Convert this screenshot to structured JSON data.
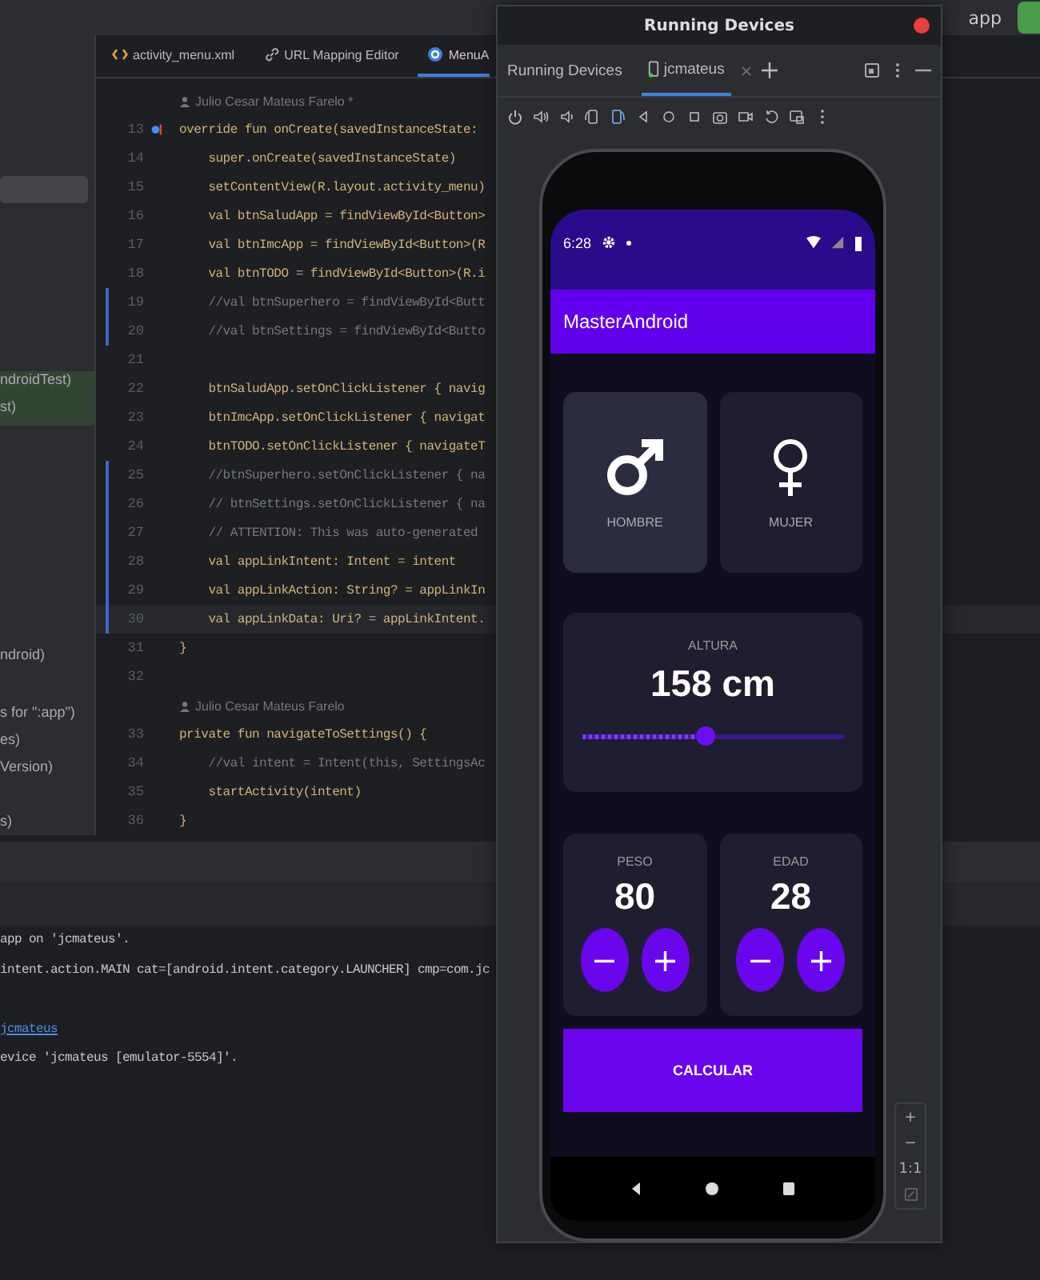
{
  "ide": {
    "run_config": "app",
    "project_rows": [
      {
        "selected": true,
        "highlighted": false
      },
      {
        "text": "ndroidTest)",
        "selected": false,
        "highlighted": true
      },
      {
        "text": "st)",
        "selected": false,
        "highlighted": true
      },
      {
        "text": "ndroid)",
        "selected": false,
        "highlighted": false
      },
      {
        "text": "s for \":app\")",
        "selected": false,
        "highlighted": false
      },
      {
        "text": "es)",
        "selected": false,
        "highlighted": false
      },
      {
        "text": "Version)",
        "selected": false,
        "highlighted": false
      },
      {
        "text": "s)",
        "selected": false,
        "highlighted": false
      }
    ],
    "editor_tabs": [
      {
        "label": "activity_menu.xml",
        "kind": "xml",
        "selected": false
      },
      {
        "label": "URL Mapping Editor",
        "kind": "link",
        "selected": false
      },
      {
        "label": "MenuA",
        "kind": "kotlin",
        "selected": true
      }
    ],
    "code_lines": [
      {
        "kind": "author",
        "text": "Julio Cesar Mateus Farelo *"
      },
      {
        "kind": "code",
        "number": "13",
        "text": "override fun onCreate(savedInstanceState:",
        "modified": false,
        "current": false,
        "gutter_icon": true
      },
      {
        "kind": "code",
        "number": "14",
        "text": "    super.onCreate(savedInstanceState)",
        "modified": false,
        "current": false,
        "gutter_icon": false
      },
      {
        "kind": "code",
        "number": "15",
        "text": "    setContentView(R.layout.activity_menu)",
        "modified": false,
        "current": false,
        "gutter_icon": false
      },
      {
        "kind": "code",
        "number": "16",
        "text": "    val btnSaludApp = findViewById<Button>",
        "modified": false,
        "current": false,
        "gutter_icon": false
      },
      {
        "kind": "code",
        "number": "17",
        "text": "    val btnImcApp = findViewById<Button>(R",
        "modified": false,
        "current": false,
        "gutter_icon": false
      },
      {
        "kind": "code",
        "number": "18",
        "text": "    val btnTODO = findViewById<Button>(R.i",
        "modified": false,
        "current": false,
        "gutter_icon": false
      },
      {
        "kind": "comment",
        "number": "19",
        "text": "    //val btnSuperhero = findViewById<Butt",
        "modified": true,
        "current": false,
        "gutter_icon": false
      },
      {
        "kind": "comment",
        "number": "20",
        "text": "    //val btnSettings = findViewById<Butto",
        "modified": true,
        "current": false,
        "gutter_icon": false
      },
      {
        "kind": "code",
        "number": "21",
        "modified": false,
        "current": false,
        "gutter_icon": false
      },
      {
        "kind": "code",
        "number": "22",
        "text": "    btnSaludApp.setOnClickListener { navig",
        "modified": false,
        "current": false,
        "gutter_icon": false
      },
      {
        "kind": "code",
        "number": "23",
        "text": "    btnImcApp.setOnClickListener { navigat",
        "modified": false,
        "current": false,
        "gutter_icon": false
      },
      {
        "kind": "code",
        "number": "24",
        "text": "    btnTODO.setOnClickListener { navigateT",
        "modified": false,
        "current": false,
        "gutter_icon": false
      },
      {
        "kind": "comment",
        "number": "25",
        "text": "    //btnSuperhero.setOnClickListener { na",
        "modified": true,
        "current": false,
        "gutter_icon": false
      },
      {
        "kind": "comment",
        "number": "26",
        "text": "    // btnSettings.setOnClickListener { na",
        "modified": true,
        "current": false,
        "gutter_icon": false
      },
      {
        "kind": "comment",
        "number": "27",
        "text": "    // ATTENTION: This was auto-generated",
        "modified": true,
        "current": false,
        "gutter_icon": false
      },
      {
        "kind": "code",
        "number": "28",
        "text": "    val appLinkIntent: Intent = intent",
        "modified": true,
        "current": false,
        "gutter_icon": false
      },
      {
        "kind": "code",
        "number": "29",
        "text": "    val appLinkAction: String? = appLinkIn",
        "modified": true,
        "current": false,
        "gutter_icon": false
      },
      {
        "kind": "code",
        "number": "30",
        "text": "    val appLinkData: Uri? = appLinkIntent.",
        "modified": true,
        "current": true,
        "gutter_icon": false
      },
      {
        "kind": "code",
        "number": "31",
        "text": "}",
        "modified": false,
        "current": false,
        "gutter_icon": false
      },
      {
        "kind": "code",
        "number": "32",
        "modified": false,
        "current": false,
        "gutter_icon": false
      },
      {
        "kind": "author",
        "text": "Julio Cesar Mateus Farelo"
      },
      {
        "kind": "code",
        "number": "33",
        "text": "private fun navigateToSettings() {",
        "modified": false,
        "current": false,
        "gutter_icon": false
      },
      {
        "kind": "comment",
        "number": "34",
        "text": "    //val intent = Intent(this, SettingsAc",
        "modified": false,
        "current": false,
        "gutter_icon": false
      },
      {
        "kind": "code",
        "number": "35",
        "text": "    startActivity(intent)",
        "modified": false,
        "current": false,
        "gutter_icon": false
      },
      {
        "kind": "code",
        "number": "36",
        "text": "}",
        "modified": false,
        "current": false,
        "gutter_icon": false
      }
    ],
    "log_lines": [
      {
        "kind": "text",
        "text": "app on 'jcmateus'."
      },
      {
        "kind": "text",
        "text": "intent.action.MAIN cat=[android.intent.category.LAUNCHER] cmp=com.jc"
      },
      {
        "kind": "blank"
      },
      {
        "kind": "link",
        "text": "jcmateus"
      },
      {
        "kind": "text",
        "text": "evice 'jcmateus [emulator-5554]'."
      }
    ]
  },
  "device_window": {
    "title": "Running Devices",
    "panel_label": "Running Devices",
    "tabs": [
      {
        "label": "jcmateus",
        "selected": true
      }
    ],
    "zoom_controls": [
      "+",
      "−",
      "1:1"
    ]
  },
  "phone": {
    "time": "6:28",
    "app_title": "MasterAndroid",
    "genders": [
      {
        "label": "HOMBRE",
        "kind": "male",
        "selected": true
      },
      {
        "label": "MUJER",
        "kind": "female",
        "selected": false
      }
    ],
    "height": {
      "label": "ALTURA",
      "value": "158 cm",
      "level": 0.47
    },
    "counters": [
      {
        "label": "PESO",
        "value": "80",
        "minus": "−",
        "plus": "+"
      },
      {
        "label": "EDAD",
        "value": "28",
        "minus": "−",
        "plus": "+"
      }
    ],
    "button": "CALCULAR"
  }
}
